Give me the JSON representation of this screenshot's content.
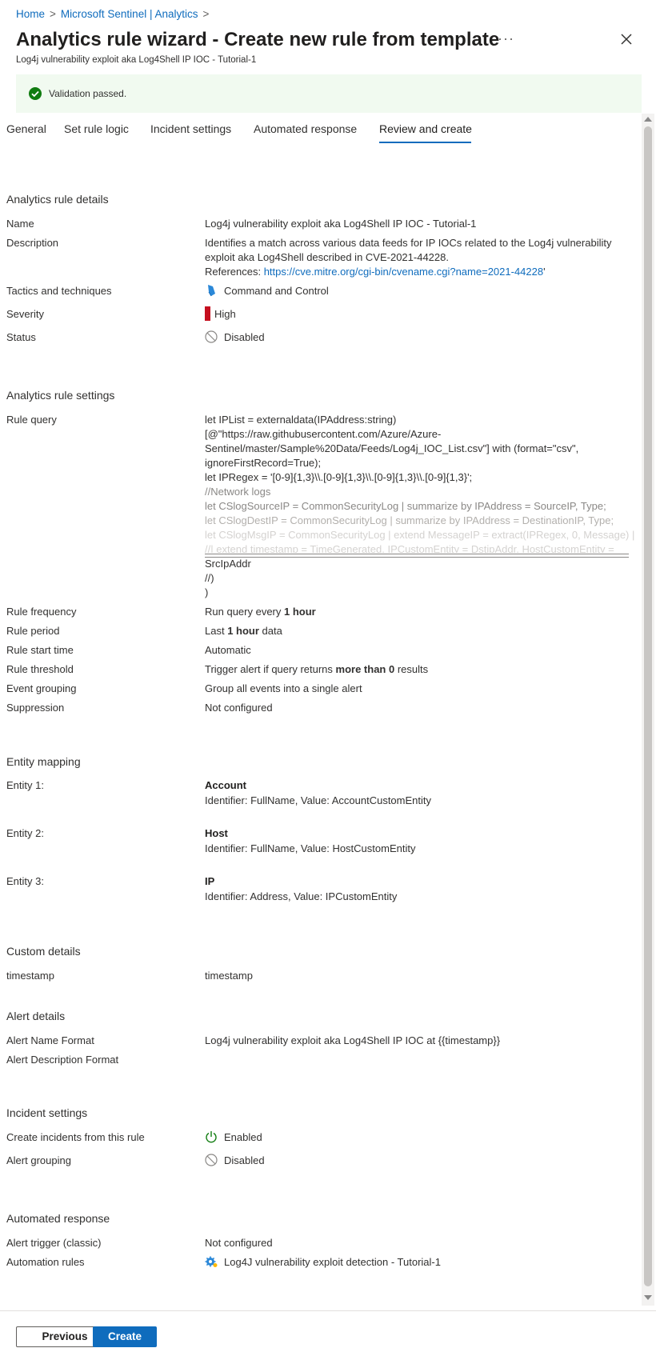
{
  "breadcrumb": {
    "home": "Home",
    "separator": ">",
    "analytics": "Microsoft Sentinel | Analytics"
  },
  "header": {
    "title": "Analytics rule wizard - Create new rule from template",
    "subtitle": "Log4j vulnerability exploit aka Log4Shell IP IOC - Tutorial-1",
    "more_icon": "ellipsis-icon",
    "close_icon": "close-icon"
  },
  "banner": {
    "text": "Validation passed.",
    "icon": "checkmark-circle-icon",
    "color": "#107c10"
  },
  "tabs": {
    "general": "General",
    "set_rule_logic": "Set rule logic",
    "incident_settings": "Incident settings",
    "automated_response": "Automated response",
    "review_and_create": "Review and create",
    "active": "Review and create"
  },
  "details": {
    "heading": "Analytics rule details",
    "name_label": "Name",
    "name_value": "Log4j vulnerability exploit aka Log4Shell IP IOC - Tutorial-1",
    "description_label": "Description",
    "description_line1": "Identifies a match across various data feeds for IP IOCs related to the Log4j vulnerability",
    "description_line2": "exploit aka Log4Shell described in CVE-2021-44228.",
    "references_prefix": "References: ",
    "references_link": "https://cve.mitre.org/cgi-bin/cvename.cgi?name=2021-44228",
    "references_suffix": "'",
    "tactics_label": "Tactics and techniques",
    "tactics_value": "Command and Control",
    "severity_label": "Severity",
    "severity_value": "High",
    "severity_color": "#c50f1f",
    "status_label": "Status",
    "status_value": "Disabled"
  },
  "settings": {
    "heading": "Analytics rule settings",
    "query_label": "Rule query",
    "query_lines": [
      "let IPList = externaldata(IPAddress:string)",
      "[@\"https://raw.githubusercontent.com/Azure/Azure-",
      "Sentinel/master/Sample%20Data/Feeds/Log4j_IOC_List.csv\"] with (format=\"csv\",",
      "ignoreFirstRecord=True);",
      "let IPRegex = '[0-9]{1,3}\\\\.[0-9]{1,3}\\\\.[0-9]{1,3}\\\\.[0-9]{1,3}';",
      "//Network logs",
      "let CSlogSourceIP = CommonSecurityLog | summarize by IPAddress = SourceIP, Type;",
      "let CSlogDestIP = CommonSecurityLog | summarize by IPAddress = DestinationIP, Type;",
      "let CSlogMsgIP = CommonSecurityLog | extend MessageIP = extract(IPRegex, 0, Message) |",
      "//| extend timestamp = TimeGenerated, IPCustomEntity = DstipAddr, HostCustomEntity =",
      "SrcIpAddr",
      "//)",
      ")"
    ],
    "frequency_label": "Rule frequency",
    "frequency_prefix": "Run query every ",
    "frequency_bold": "1 hour",
    "period_label": "Rule period",
    "period_prefix": "Last ",
    "period_bold": "1 hour",
    "period_suffix": " data",
    "start_label": "Rule start time",
    "start_value": "Automatic",
    "threshold_label": "Rule threshold",
    "threshold_prefix": "Trigger alert if query returns ",
    "threshold_bold": "more than 0",
    "threshold_suffix": " results",
    "grouping_label": "Event grouping",
    "grouping_value": "Group all events into a single alert",
    "suppression_label": "Suppression",
    "suppression_value": "Not configured"
  },
  "entity_mapping": {
    "heading": "Entity mapping",
    "entities": [
      {
        "label": "Entity 1:",
        "type": "Account",
        "identifier": "Identifier: FullName, Value: AccountCustomEntity"
      },
      {
        "label": "Entity 2:",
        "type": "Host",
        "identifier": "Identifier: FullName, Value: HostCustomEntity"
      },
      {
        "label": "Entity 3:",
        "type": "IP",
        "identifier": "Identifier: Address, Value: IPCustomEntity"
      }
    ]
  },
  "custom_details": {
    "heading": "Custom details",
    "key": "timestamp",
    "value": "timestamp"
  },
  "alert_details": {
    "heading": "Alert details",
    "name_format_label": "Alert Name Format",
    "name_format_value": "Log4j vulnerability exploit aka Log4Shell IP IOC at {{timestamp}}",
    "description_format_label": "Alert Description Format"
  },
  "incident_settings": {
    "heading": "Incident settings",
    "create_label": "Create incidents from this rule",
    "create_value": "Enabled",
    "grouping_label": "Alert grouping",
    "grouping_value": "Disabled"
  },
  "automated_response": {
    "heading": "Automated response",
    "trigger_label": "Alert trigger (classic)",
    "trigger_value": "Not configured",
    "rules_label": "Automation rules",
    "rules_value": "Log4J vulnerability exploit detection - Tutorial-1"
  },
  "footer": {
    "previous": "Previous",
    "create": "Create"
  },
  "colors": {
    "accent": "#0f6cbd",
    "enabled_green": "#107c10"
  }
}
